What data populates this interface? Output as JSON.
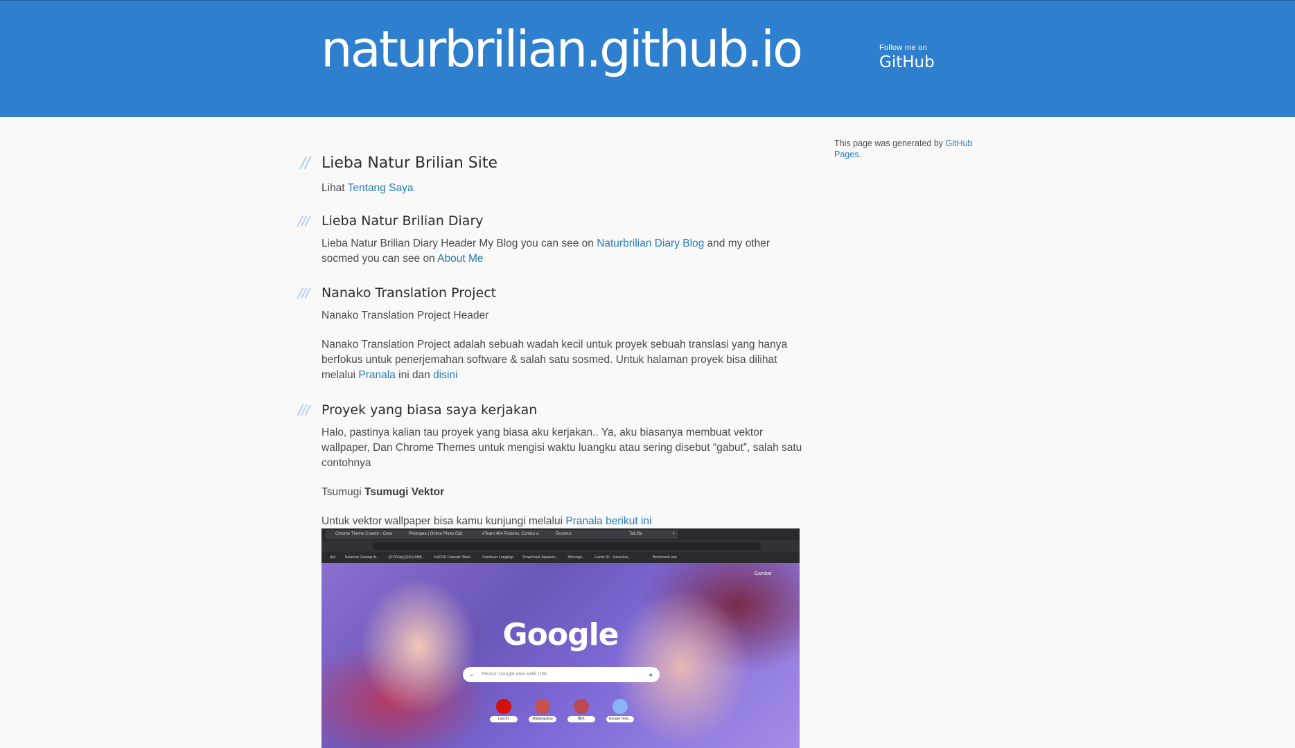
{
  "header": {
    "site_title": "naturbrilian.github.io",
    "follow_small": "Follow me on",
    "follow_big": "GitHub"
  },
  "sections": [
    {
      "slashes": "//",
      "title": "Lieba Natur Brilian Site",
      "p1_prefix": "Lihat ",
      "p1_link": "Tentang Saya"
    },
    {
      "slashes": "///",
      "title": "Lieba Natur Brilian Diary",
      "p1_text": "Lieba Natur Brilian Diary Header My Blog you can see on ",
      "p1_link1": "Naturbrilian Diary Blog",
      "p1_mid": " and my other socmed you can see on ",
      "p1_link2": "About Me"
    },
    {
      "slashes": "///",
      "title": "Nanako Translation Project",
      "p1_text": "Nanako Translation Project Header",
      "p2_text": "Nanako Translation Project adalah sebuah wadah kecil untuk proyek sebuah translasi yang hanya berfokus untuk penerjemahan software & salah satu sosmed. Untuk halaman proyek bisa dilihat melalui ",
      "p2_link1": "Pranala",
      "p2_mid": " ini dan ",
      "p2_link2": "disini"
    },
    {
      "slashes": "///",
      "title": "Proyek yang biasa saya kerjakan",
      "p1_text": "Halo, pastinya kalian tau proyek yang biasa aku kerjakan.. Ya, aku biasanya membuat vektor wallpaper, Dan Chrome Themes untuk mengisi waktu luangku atau sering disebut “gabut”, salah satu contohnya",
      "p2_prefix": "Tsumugi ",
      "p2_bold": "Tsumugi Vektor",
      "p3_text": "Untuk vektor wallpaper bisa kamu kunjungi melalui ",
      "p3_link": "Pranala berikut ini"
    }
  ],
  "sidebar": {
    "text": "This page was generated by ",
    "link": "GitHub Pages",
    "suffix": "."
  },
  "screenshot": {
    "tabs": [
      "Chrome Theme Creator - Crea",
      "Photopea | Online Photo Edit",
      "#Team 404 Pictures, Comics a",
      "Ekstensi",
      "Tab Ba"
    ],
    "bookmarks": [
      "Apl",
      "Selamat Datang di...",
      "[DVDRip] [MV] AKB...",
      "KAORI Fansub: Wari...",
      "Panduan Lengkap",
      "Download Japanes...",
      "Nihongo...",
      "Gantz ID - Downloa...",
      "Bookmark lain"
    ],
    "google_logo": "Google",
    "search_placeholder": "Telusuri Google atau ketik URL",
    "shortcuts": [
      "Last.fm",
      "MahjongSoul",
      "猫水",
      "Google Terje..."
    ],
    "top_right": "Gambar"
  }
}
